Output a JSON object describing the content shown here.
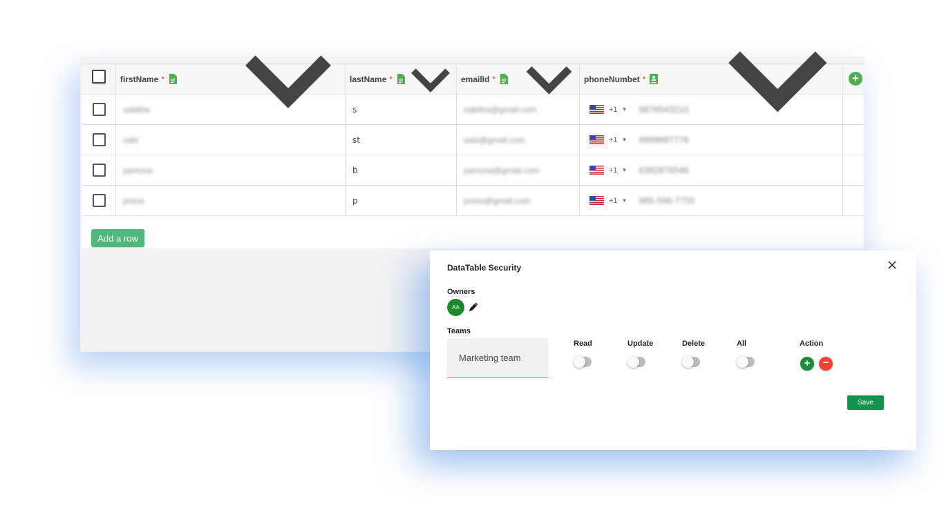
{
  "table": {
    "columns": [
      {
        "label": "firstName",
        "required": "*",
        "icon": "document-icon"
      },
      {
        "label": "lastName",
        "required": "*",
        "icon": "document-icon"
      },
      {
        "label": "emailId",
        "required": "*",
        "icon": "document-icon"
      },
      {
        "label": "phoneNumbet",
        "required": "*",
        "icon": "contact-card-icon"
      }
    ],
    "rows": [
      {
        "firstName": "sabitha",
        "lastName": "s",
        "emailId": "sabitha@gmail.com",
        "dial": "+1",
        "phone": "9876543210"
      },
      {
        "firstName": "sabi",
        "lastName": "st",
        "emailId": "sabi@gmail.com",
        "dial": "+1",
        "phone": "9999887776"
      },
      {
        "firstName": "yamuna",
        "lastName": "b",
        "emailId": "yamuna@gmail.com",
        "dial": "+1",
        "phone": "6382876546"
      },
      {
        "firstName": "prasa",
        "lastName": "p",
        "emailId": "prasa@gmail.com",
        "dial": "+1",
        "phone": "985-566-7755"
      }
    ],
    "add_row_label": "Add a row",
    "add_column_label": "+",
    "accent_color": "#4caf50"
  },
  "dialog": {
    "title": "DataTable Security",
    "owners_label": "Owners",
    "owner_initials": "AA",
    "teams_label": "Teams",
    "team_value": "Marketing team",
    "permissions": [
      "Read",
      "Update",
      "Delete",
      "All"
    ],
    "action_label": "Action",
    "add_symbol": "+",
    "remove_symbol": "−",
    "save_label": "Save",
    "primary_color": "#15934a",
    "danger_color": "#f44336"
  }
}
